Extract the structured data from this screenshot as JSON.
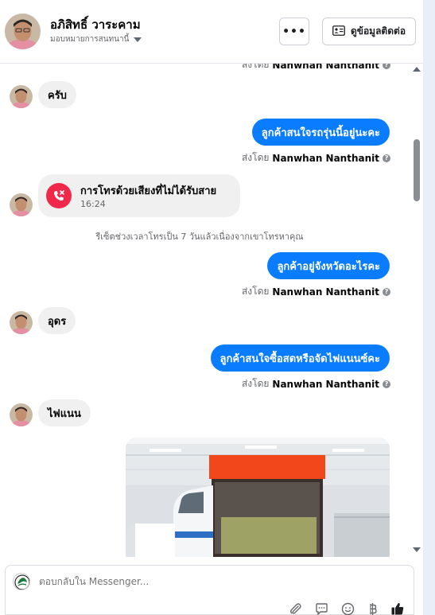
{
  "header": {
    "name": "อภิสิทธิ์ วาระคาม",
    "assignee": "มอบหมายการสนทนานี้",
    "more_label": "•••",
    "contact_button_label": "ดูข้อมูลติดต่อ"
  },
  "messages": {
    "partial_sent_by_prefix": "ส่งโดย",
    "partial_sent_by_name": "Nanwhan Nanthanit",
    "in_1": "ครับ",
    "out_1": "ลูกค้าสนใจรถรุ่นนี้อยู่นะคะ",
    "sent_by_prefix": "ส่งโดย",
    "sent_by_name": "Nanwhan Nanthanit",
    "call_title": "การโทรด้วยเสียงที่ไม่ได้รับสาย",
    "call_time": "16:24",
    "system_note": "รีเซ็ตช่วงเวลาโทรเป็น 7 วันแล้วเนื่องจากเขาโทรหาคุณ",
    "out_2": "ลูกค้าอยู่จังหวัดอะไรคะ",
    "in_2": "อุดร",
    "out_3": "ลูกค้าสนใจซื้อสดหรือจัดไฟแนนซ์คะ",
    "in_3": "ไฟแนน"
  },
  "composer": {
    "placeholder": "ตอบกลับใน Messenger..."
  },
  "icons": {
    "attach": "paperclip-icon",
    "saved_replies": "chat-bubble-icon",
    "emoji": "smiley-icon",
    "payment": "baht-icon",
    "like": "thumbs-up-icon"
  },
  "colors": {
    "outgoing_bubble": "#0a7cff",
    "incoming_bubble": "#f0f0f0",
    "missed_call": "#f02849"
  }
}
